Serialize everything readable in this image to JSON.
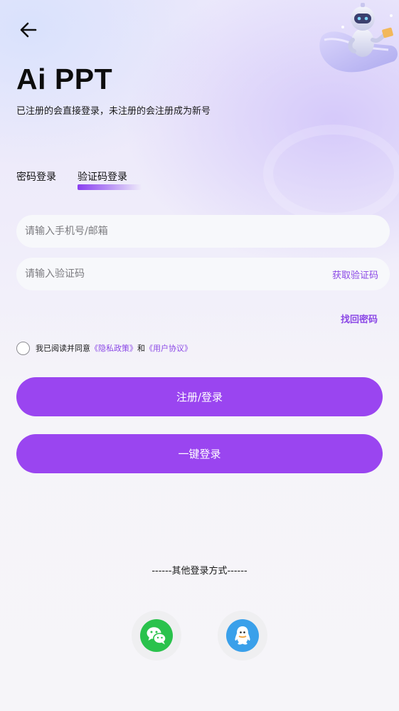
{
  "header": {
    "back_icon": "arrow-left-icon",
    "title": "Ai PPT",
    "subtitle": "已注册的会直接登录，未注册的会注册成为新号",
    "illustration_icon": "robot-illustration-icon"
  },
  "tabs": [
    {
      "label": "密码登录",
      "active": false
    },
    {
      "label": "验证码登录",
      "active": true
    }
  ],
  "form": {
    "phone_placeholder": "请输入手机号/邮箱",
    "code_placeholder": "请输入验证码",
    "get_code_label": "获取验证码",
    "forgot_label": "找回密码"
  },
  "agreement": {
    "prefix": "我已阅读并同意",
    "privacy": "《隐私政策》",
    "conjunction": "和",
    "terms": "《用户协议》",
    "checked": false
  },
  "buttons": {
    "register_login": "注册/登录",
    "one_key_login": "一键登录"
  },
  "other_login": {
    "label": "------其他登录方式------",
    "options": [
      {
        "name": "wechat",
        "icon": "wechat-icon",
        "color": "#2ac24c"
      },
      {
        "name": "qq",
        "icon": "qq-icon",
        "color": "#3aa0ea"
      }
    ]
  },
  "colors": {
    "accent": "#9a45f0",
    "link": "#8b48e6"
  }
}
